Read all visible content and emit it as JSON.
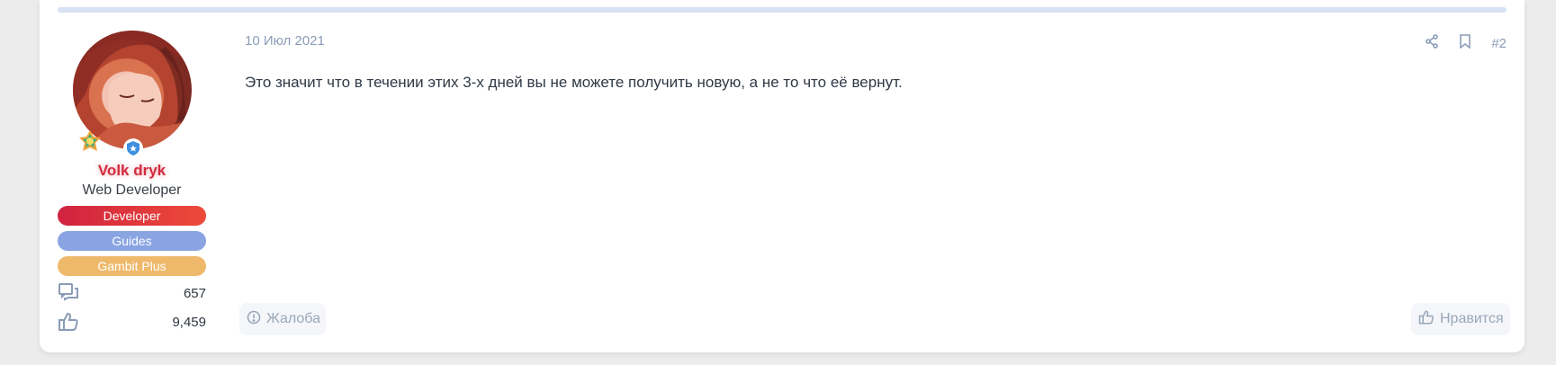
{
  "post": {
    "date": "10 Июл 2021",
    "number": "#2",
    "message": "Это значит что в течении этих 3-х дней вы не можете получить новую, а не то что её вернут.",
    "report_label": "Жалоба",
    "like_label": "Нравится"
  },
  "author": {
    "name": "Volk dryk",
    "title": "Web Developer",
    "badges": [
      "Developer",
      "Guides",
      "Gambit Plus"
    ],
    "messages_count": "657",
    "reactions_count": "9,459"
  },
  "colors": {
    "username": "#d22b3f",
    "developer_badge": "#e0333f",
    "guides_badge": "#8aa4e2",
    "gambit_badge": "#efb96b",
    "muted": "#8b9cb6"
  },
  "icons": [
    "share-icon",
    "bookmark-icon",
    "report-icon",
    "like-icon",
    "messages-icon",
    "reactions-icon",
    "staff-shield-icon",
    "award-icon"
  ]
}
